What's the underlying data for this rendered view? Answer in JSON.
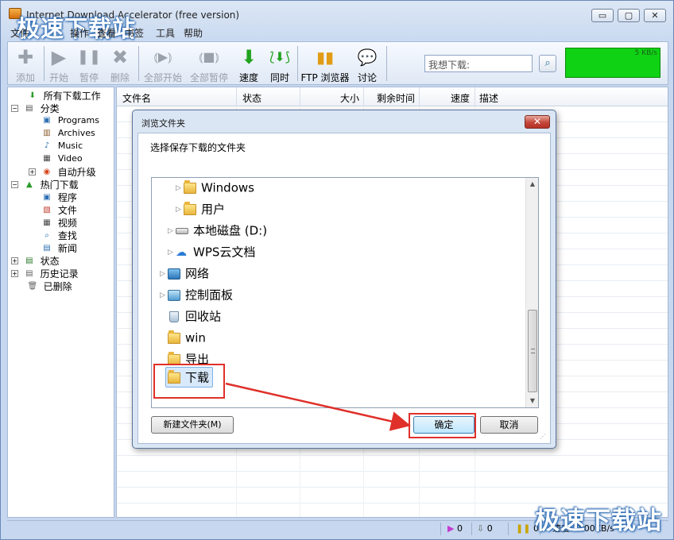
{
  "window": {
    "title": "Internet Download Accelerator (free version)",
    "watermark": "极速下载站",
    "controls": {
      "min": "▭",
      "max": "▢",
      "close": "✕"
    }
  },
  "menu": [
    "文件",
    "操作",
    "查看",
    "书签",
    "工具",
    "帮助"
  ],
  "toolbar": {
    "buttons": [
      {
        "label": "添加",
        "icon": "plus-icon",
        "glyph": "✚",
        "enabled": false
      },
      {
        "label": "开始",
        "icon": "play-icon",
        "glyph": "▶",
        "enabled": false
      },
      {
        "label": "暂停",
        "icon": "pause-icon",
        "glyph": "❚❚",
        "enabled": false
      },
      {
        "label": "删除",
        "icon": "delete-icon",
        "glyph": "✖",
        "enabled": false
      },
      {
        "label": "全部开始",
        "icon": "start-all-icon",
        "glyph": "⦅▶⦆",
        "enabled": false
      },
      {
        "label": "全部暂停",
        "icon": "pause-all-icon",
        "glyph": "⦅■⦆",
        "enabled": false
      },
      {
        "label": "速度",
        "icon": "speed-arrow-icon",
        "glyph": "⬇",
        "enabled": true,
        "color": "#22a31f"
      },
      {
        "label": "同时",
        "icon": "parallel-icon",
        "glyph": "⟅⬇⟆",
        "enabled": true,
        "color": "#22a31f"
      },
      {
        "label": "FTP 浏览器",
        "icon": "ftp-browser-icon",
        "glyph": "▮▮",
        "enabled": true,
        "color": "#e19c16"
      },
      {
        "label": "讨论",
        "icon": "chat-bubble-icon",
        "glyph": "💬",
        "enabled": true,
        "color": "#2b8ad8"
      }
    ],
    "search_placeholder": "我想下载:",
    "speed_graph_label": "5 KB/s",
    "speed_graph_color": "#0fd214"
  },
  "tree": {
    "items": [
      {
        "label": "所有下载工作",
        "icon": "all-downloads-icon",
        "glyph": "⬇",
        "color": "#2a9a2a"
      },
      {
        "label": "分类",
        "icon": "category-icon",
        "glyph": "▤",
        "color": "#555"
      },
      {
        "label": "Programs",
        "icon": "programs-icon",
        "glyph": "▣",
        "color": "#2d6fb3"
      },
      {
        "label": "Archives",
        "icon": "archives-icon",
        "glyph": "▥",
        "color": "#8b5a2b"
      },
      {
        "label": "Music",
        "icon": "music-icon",
        "glyph": "♪",
        "color": "#2d6fb3"
      },
      {
        "label": "Video",
        "icon": "video-icon",
        "glyph": "▦",
        "color": "#444"
      },
      {
        "label": "自动升级",
        "icon": "auto-upgrade-icon",
        "glyph": "◉",
        "color": "#d6451b"
      },
      {
        "label": "热门下载",
        "icon": "hot-downloads-icon",
        "glyph": "▲",
        "color": "#2a9a2a"
      },
      {
        "label": "程序",
        "icon": "program-icon",
        "glyph": "▣",
        "color": "#2d6fb3"
      },
      {
        "label": "文件",
        "icon": "file-icon",
        "glyph": "▧",
        "color": "#c0392b"
      },
      {
        "label": "视频",
        "icon": "film-icon",
        "glyph": "▦",
        "color": "#444"
      },
      {
        "label": "查找",
        "icon": "search-icon",
        "glyph": "⌕",
        "color": "#2d6fb3"
      },
      {
        "label": "新闻",
        "icon": "news-icon",
        "glyph": "▤",
        "color": "#2d6fb3"
      },
      {
        "label": "状态",
        "icon": "status-icon",
        "glyph": "▤",
        "color": "#2a7a2a"
      },
      {
        "label": "历史记录",
        "icon": "history-icon",
        "glyph": "▤",
        "color": "#666"
      },
      {
        "label": "已删除",
        "icon": "trash-icon",
        "glyph": "🗑",
        "color": "#666"
      }
    ]
  },
  "list": {
    "columns": [
      "文件名",
      "状态",
      "大小",
      "剩余时间",
      "速度",
      "描述"
    ]
  },
  "statusbar": {
    "active": "0",
    "queued": "0",
    "paused": "0",
    "speed": "速度: 0.00KB/s"
  },
  "dialog": {
    "title": "浏览文件夹",
    "prompt": "选择保存下载的文件夹",
    "folders": [
      {
        "label": "Windows",
        "icon": "folder-icon",
        "kind": "folder"
      },
      {
        "label": "用户",
        "icon": "folder-icon",
        "kind": "folder"
      },
      {
        "label": "本地磁盘 (D:)",
        "icon": "drive-icon",
        "kind": "drive"
      },
      {
        "label": "WPS云文档",
        "icon": "cloud-icon",
        "kind": "cloud"
      },
      {
        "label": "网络",
        "icon": "network-icon",
        "kind": "network"
      },
      {
        "label": "控制面板",
        "icon": "control-panel-icon",
        "kind": "control"
      },
      {
        "label": "回收站",
        "icon": "recycle-bin-icon",
        "kind": "recycle"
      },
      {
        "label": "win",
        "icon": "folder-icon",
        "kind": "folder"
      },
      {
        "label": "导出",
        "icon": "folder-icon",
        "kind": "folder"
      },
      {
        "label": "下载",
        "icon": "folder-icon",
        "kind": "folder",
        "selected": true
      }
    ],
    "new_folder": "新建文件夹(M)",
    "ok": "确定",
    "cancel": "取消",
    "close": "✕"
  },
  "annotation": {
    "color": "#e0302a"
  }
}
